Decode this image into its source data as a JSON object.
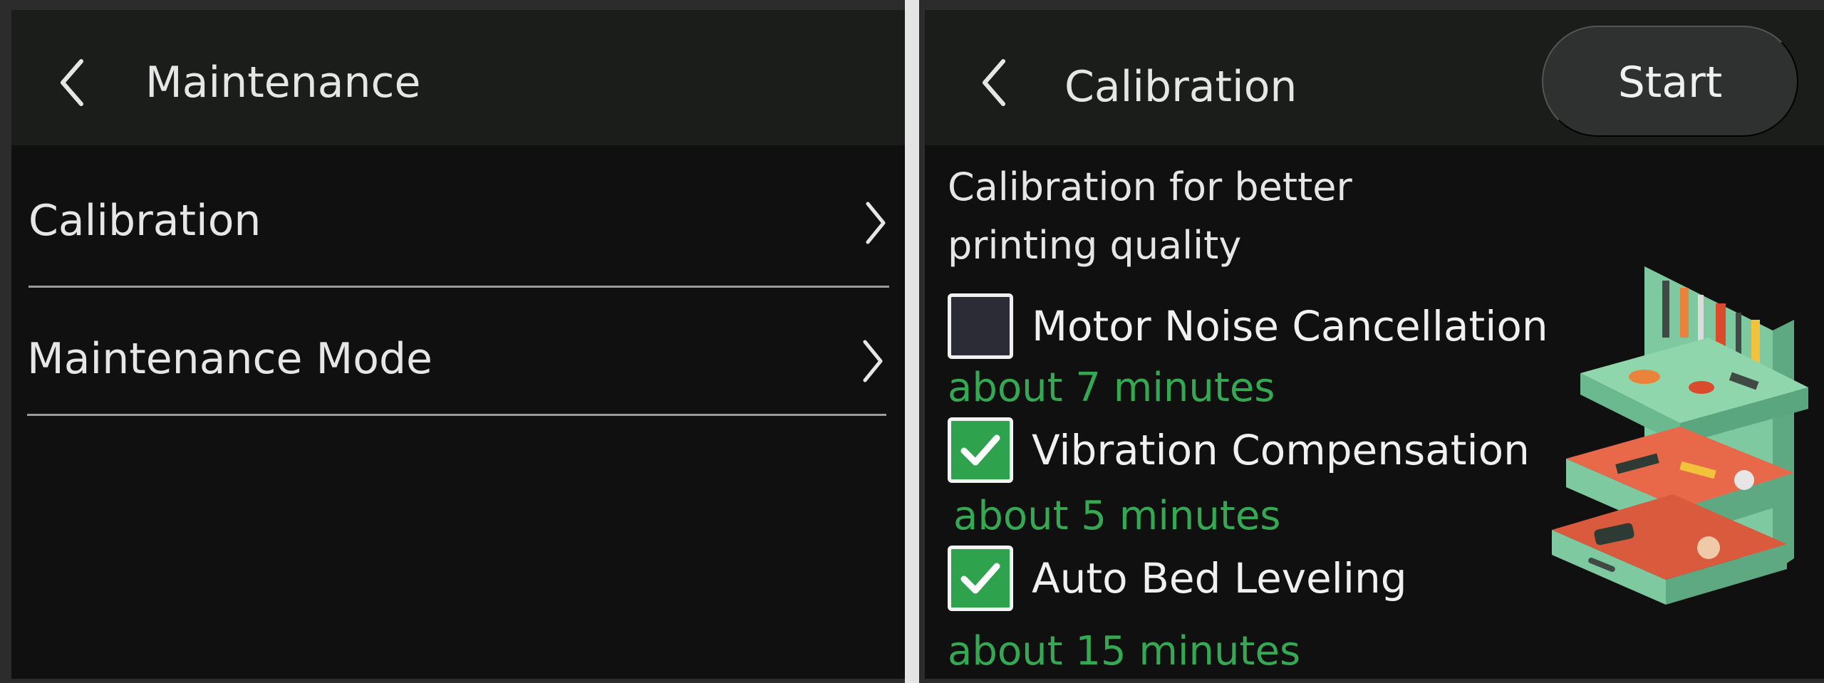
{
  "left_panel": {
    "header": {
      "title": "Maintenance"
    },
    "menu": [
      {
        "label": "Calibration"
      },
      {
        "label": "Maintenance Mode"
      }
    ]
  },
  "right_panel": {
    "header": {
      "title": "Calibration",
      "start_label": "Start"
    },
    "intro_text": "Calibration for better printing quality",
    "options": [
      {
        "name": "Motor Noise Cancellation",
        "duration": "about 7 minutes",
        "checked": false
      },
      {
        "name": "Vibration Compensation",
        "duration": "about 5 minutes",
        "checked": true
      },
      {
        "name": "Auto Bed Leveling",
        "duration": "about 15 minutes",
        "checked": true
      }
    ]
  },
  "icons": {
    "back": "chevron-left-icon",
    "row_arrow": "chevron-right-icon",
    "check": "checkmark-icon"
  },
  "colors": {
    "background": "#101010",
    "header": "#1b1d1b",
    "text": "#e6e6e6",
    "accent_green": "#34a853",
    "checkbox_checked": "#2fa24d",
    "button": "#2f3130"
  }
}
